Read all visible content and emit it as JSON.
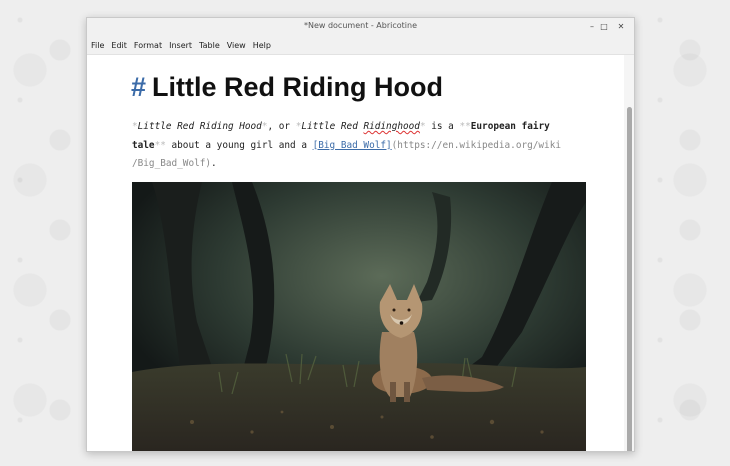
{
  "window": {
    "title": "*New document - Abricotine"
  },
  "menu": [
    "File",
    "Edit",
    "Format",
    "Insert",
    "Table",
    "View",
    "Help"
  ],
  "document": {
    "heading_marker": "#",
    "heading": "Little Red Riding Hood",
    "para": {
      "s1": "*",
      "t1": "Little Red Riding Hood",
      "s2": "*",
      "t2": ", or ",
      "s3": "*",
      "t3": "Little Red ",
      "t3b": "Ridinghood",
      "s4": "*",
      "t4": " is a ",
      "s5": "**",
      "t5": "European fairy",
      "t5b": "tale",
      "s6": "**",
      "t6": " about a young girl and a ",
      "link_text": "[Big Bad Wolf]",
      "link_url_1": "(https://en.wikipedia.org/wiki",
      "link_url_2": "/Big_Bad_Wolf)",
      "end": "."
    }
  }
}
